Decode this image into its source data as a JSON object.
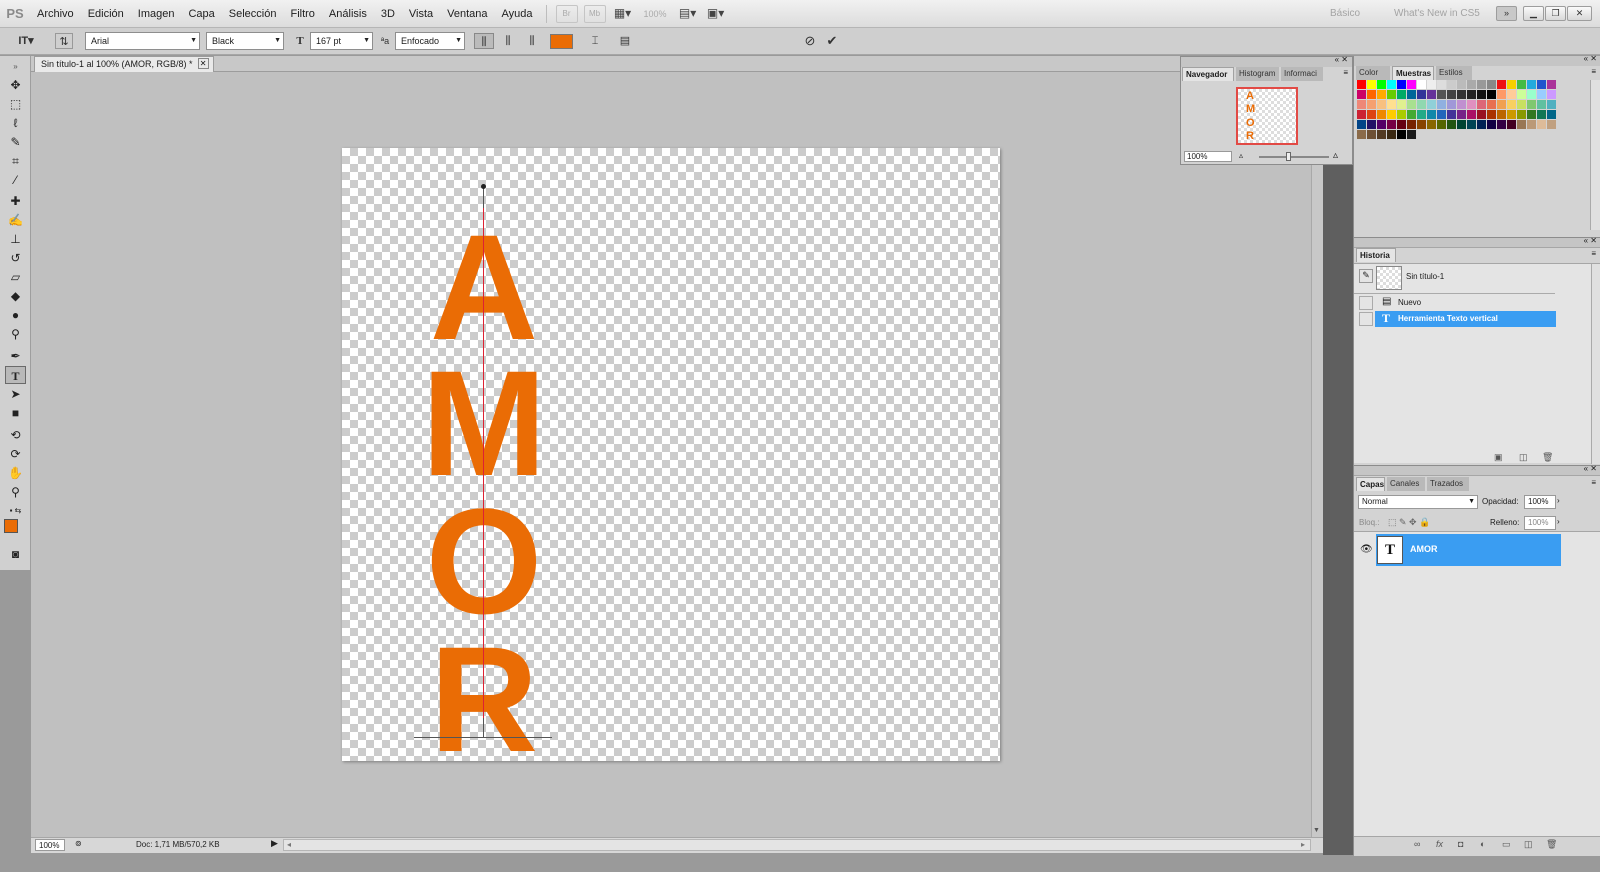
{
  "menubar": {
    "logo": "PS",
    "items": [
      "Archivo",
      "Edición",
      "Imagen",
      "Capa",
      "Selección",
      "Filtro",
      "Análisis",
      "3D",
      "Vista",
      "Ventana",
      "Ayuda"
    ],
    "zoom": "100%",
    "workspace_basic": "Básico",
    "whats_new": "What's New in CS5",
    "icon_br": "Br",
    "icon_mb": "Mb"
  },
  "options": {
    "font_family": "Arial",
    "font_style": "Black",
    "font_size": "167 pt",
    "antialias_label": "ªa",
    "antialias": "Enfocado",
    "text_color": "#ea6c05"
  },
  "document": {
    "tab_title": "Sin título-1 al 100% (AMOR, RGB/8) *",
    "letters": [
      "A",
      "M",
      "O",
      "R"
    ],
    "text_color": "#ea6c05"
  },
  "status": {
    "zoom": "100%",
    "doc_info": "Doc: 1,71 MB/570,2 KB"
  },
  "navigator": {
    "tabs": [
      "Navegador",
      "Histogram",
      "Informaci"
    ],
    "zoom": "100%",
    "thumb_letters": [
      "A",
      "M",
      "O",
      "R"
    ]
  },
  "swatches": {
    "tabs": [
      "Color",
      "Muestras",
      "Estilos"
    ],
    "colors": [
      "#ff0000",
      "#ffff00",
      "#00ff00",
      "#00ffff",
      "#0000ff",
      "#ff00ff",
      "#ffffff",
      "#eeeeee",
      "#dddddd",
      "#cccccc",
      "#bbbbbb",
      "#aaaaaa",
      "#999999",
      "#888888",
      "#ee1111",
      "#f6d000",
      "#44bb44",
      "#22aadd",
      "#2255cc",
      "#aa3399",
      "#cc0066",
      "#ff6600",
      "#ffaa00",
      "#66cc00",
      "#00aa66",
      "#006699",
      "#333399",
      "#663399",
      "#555555",
      "#444444",
      "#333333",
      "#222222",
      "#111111",
      "#000000",
      "#ff9966",
      "#ffcc99",
      "#ccff99",
      "#99ffcc",
      "#99ccff",
      "#cc99ff",
      "#ee8877",
      "#f5a070",
      "#f8c080",
      "#ffe090",
      "#e0f090",
      "#a8e090",
      "#90d8b0",
      "#90d0d8",
      "#90b0e0",
      "#a098d8",
      "#c090d0",
      "#e090c0",
      "#dd6677",
      "#e87050",
      "#f0a050",
      "#f8d060",
      "#c8e060",
      "#80c870",
      "#60c0a0",
      "#50b0c0",
      "#cc2233",
      "#dd4411",
      "#ee8800",
      "#ffcc00",
      "#aacc00",
      "#44aa33",
      "#22aa88",
      "#1188aa",
      "#2266bb",
      "#443399",
      "#772288",
      "#aa1166",
      "#991122",
      "#aa3300",
      "#bb6600",
      "#cc9900",
      "#889900",
      "#337722",
      "#117755",
      "#006688",
      "#004488",
      "#221166",
      "#550066",
      "#770044",
      "#660011",
      "#772200",
      "#884400",
      "#886600",
      "#556600",
      "#225511",
      "#004433",
      "#004455",
      "#002255",
      "#110044",
      "#330044",
      "#440022",
      "#997755",
      "#bb9977",
      "#ddbb99",
      "#c0a080",
      "#8b6b4a",
      "#6e5034",
      "#533a22",
      "#3a2812",
      "#000000",
      "#1a1a1a"
    ]
  },
  "history": {
    "tab": "Historia",
    "snapshot": "Sin título-1",
    "items": [
      "Nuevo",
      "Herramienta Texto vertical"
    ]
  },
  "layers": {
    "tabs": [
      "Capas",
      "Canales",
      "Trazados"
    ],
    "blend_mode": "Normal",
    "opacity_label": "Opacidad:",
    "opacity": "100%",
    "lock_label": "Bloq.:",
    "fill_label": "Relleno:",
    "fill": "100%",
    "layer_name": "AMOR",
    "layer_thumb": "T"
  }
}
